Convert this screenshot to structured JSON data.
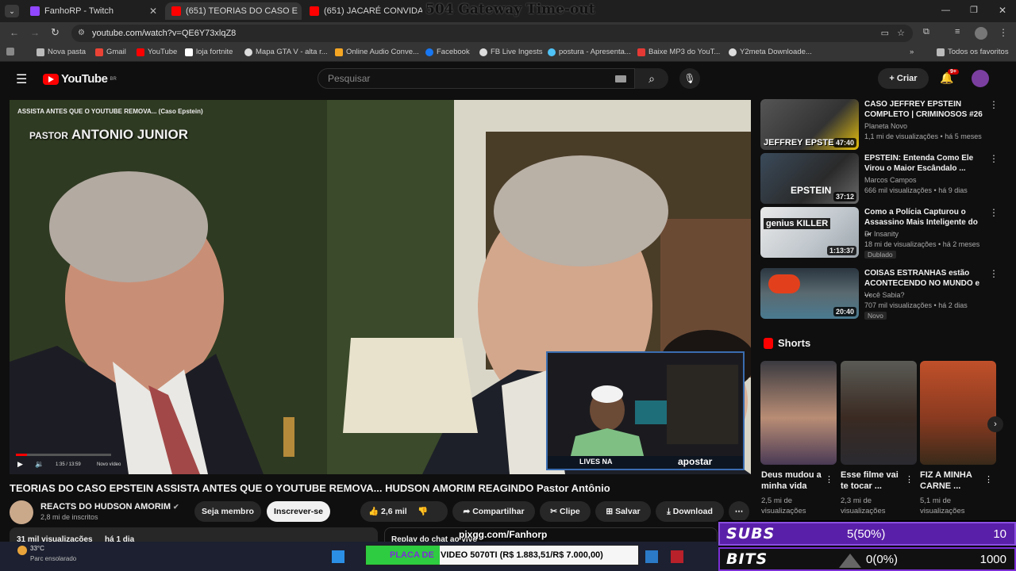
{
  "browser": {
    "overlay_title": "504 Gateway Time-out",
    "tabs": [
      {
        "label": "FanhoRP - Twitch",
        "favicon_color": "#9146ff"
      },
      {
        "label": "(651) TEORIAS DO CASO E",
        "favicon_color": "#ff0000"
      },
      {
        "label": "(651) JACARÉ CONVIDA RAFA F",
        "favicon_color": "#ff0000"
      }
    ],
    "url": "youtube.com/watch?v=QE6Y73xlqZ8",
    "bookmarks": [
      {
        "label": "Nova pasta",
        "color": "#bbbbbb"
      },
      {
        "label": "Gmail",
        "color": "#ea4335"
      },
      {
        "label": "YouTube",
        "color": "#ff0000"
      },
      {
        "label": "loja fortnite",
        "color": "#ffffff"
      },
      {
        "label": "Mapa GTA V - alta r...",
        "color": "#dddddd"
      },
      {
        "label": "Online Audio Conve...",
        "color": "#f5a623"
      },
      {
        "label": "Facebook",
        "color": "#1877f2"
      },
      {
        "label": "FB Live Ingests",
        "color": "#dddddd"
      },
      {
        "label": "postura - Apresenta...",
        "color": "#4fc3f7"
      },
      {
        "label": "Baixe MP3 do YouT...",
        "color": "#e53935"
      },
      {
        "label": "Y2meta Downloade...",
        "color": "#dddddd"
      },
      {
        "label": "Todos os favoritos",
        "color": "#bbbbbb"
      }
    ]
  },
  "youtube": {
    "logo": "YouTube",
    "logo_region": "BR",
    "search_placeholder": "Pesquisar",
    "create_label": "Criar",
    "notif_count": "9+"
  },
  "video": {
    "top_caption": "ASSISTA ANTES QUE O YOUTUBE REMOVA... (Caso Epstein)",
    "name_overlay_prefix": "PASTOR",
    "name_overlay": "ANTONIO JUNIOR",
    "time": "1:35 / 13:59",
    "next_label": "Novo vídeo",
    "webcam_banner": "LIVES NA",
    "webcam_brand": "apostar",
    "title": "TEORIAS DO CASO EPSTEIN ASSISTA ANTES QUE O YOUTUBE REMOVA... HUDSON AMORIM REAGINDO Pastor Antônio",
    "channel": "REACTS DO HUDSON AMORIM",
    "subscribers": "2,8 mi de inscritos",
    "member_label": "Seja membro",
    "subscribe_label": "Inscrever-se",
    "likes": "2,6 mil",
    "share_label": "Compartilhar",
    "clip_label": "Clipe",
    "save_label": "Salvar",
    "download_label": "Download",
    "views": "31 mil visualizações",
    "age": "há 1 dia",
    "chat_replay": "Replay do chat ao vivo"
  },
  "recommendations": [
    {
      "title": "CASO JEFFREY EPSTEIN COMPLETO | CRIMINOSOS #26",
      "channel": "Planeta Novo",
      "meta": "1,1 mi de visualizações • há 5 meses",
      "duration": "47:40",
      "thumb_text": "JEFFREY EPSTEIN",
      "badge": ""
    },
    {
      "title": "EPSTEIN: Entenda Como Ele Virou o Maior Escândalo ...",
      "channel": "Marcos Campos",
      "meta": "666 mil visualizações • há 9 dias",
      "duration": "37:12",
      "thumb_text": "EPSTEIN",
      "badge": ""
    },
    {
      "title": "Como a Polícia Capturou o Assassino Mais Inteligente do ...",
      "channel": "Dr Insanity",
      "meta": "18 mi de visualizações • há 2 meses",
      "duration": "1:13:37",
      "thumb_text": "genius KILLER",
      "badge": "Dublado"
    },
    {
      "title": "COISAS ESTRANHAS estão ACONTECENDO NO MUNDO e ...",
      "channel": "Você Sabia?",
      "meta": "707 mil visualizações • há 2 dias",
      "duration": "20:40",
      "thumb_text": "",
      "badge": "Novo"
    }
  ],
  "shorts_header": "Shorts",
  "shorts": [
    {
      "title": "Deus mudou a minha vida",
      "views": "2,5 mi de visualizações"
    },
    {
      "title": "Esse filme vai te tocar ...",
      "views": "2,3 mi de visualizações"
    },
    {
      "title": "FIZ A MINHA CARNE ...",
      "views": "5,1 mi de visualizações"
    }
  ],
  "stream": {
    "pix_label": "pixgg.com/Fanhorp",
    "goal_label_prefix": "PLACA DE",
    "goal_text": "VIDEO 5070TI (R$ 1.883,51/R$ 7.000,00)",
    "goal_progress": 0.27,
    "weather_temp": "33°C",
    "weather_desc": "Parc ensolarado",
    "subs_label": "SUBS",
    "subs_value": "5(50%)",
    "subs_target": "10",
    "bits_label": "BITS",
    "bits_value": "0(0%)",
    "bits_target": "1000"
  },
  "colors": {
    "yt_red": "#ff0000",
    "goal_green": "#2ecc40",
    "goal_purple": "#7b2fd6"
  }
}
